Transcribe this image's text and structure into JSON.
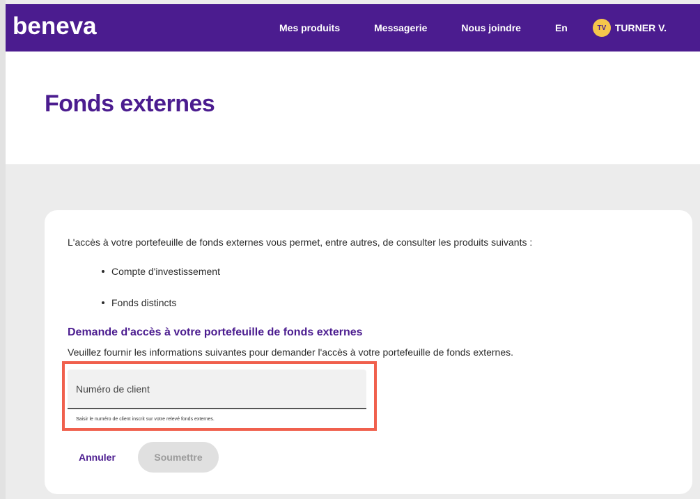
{
  "header": {
    "logo": "beneva",
    "nav": [
      "Mes produits",
      "Messagerie",
      "Nous joindre"
    ],
    "language": "En",
    "user": {
      "initials": "TV",
      "name": "TURNER V."
    }
  },
  "page": {
    "title": "Fonds externes"
  },
  "content": {
    "intro": "L'accès à votre portefeuille de fonds externes vous permet, entre autres, de consulter les produits suivants :",
    "products": [
      "Compte d'investissement",
      "Fonds distincts"
    ],
    "request_heading": "Demande d'accès à votre portefeuille de fonds externes",
    "request_desc": "Veuillez fournir les informations suivantes pour demander l'accès à votre portefeuille de fonds externes.",
    "client_field": {
      "placeholder": "Numéro de client",
      "value": "",
      "helper": "Saisir le numéro de client inscrit sur votre relevé fonds externes."
    },
    "actions": {
      "cancel": "Annuler",
      "submit": "Soumettre"
    }
  },
  "colors": {
    "brand": "#4b1c8f",
    "avatar": "#f5c64b",
    "highlight": "#f0604d",
    "disabled_button": "#e0e0e0"
  }
}
